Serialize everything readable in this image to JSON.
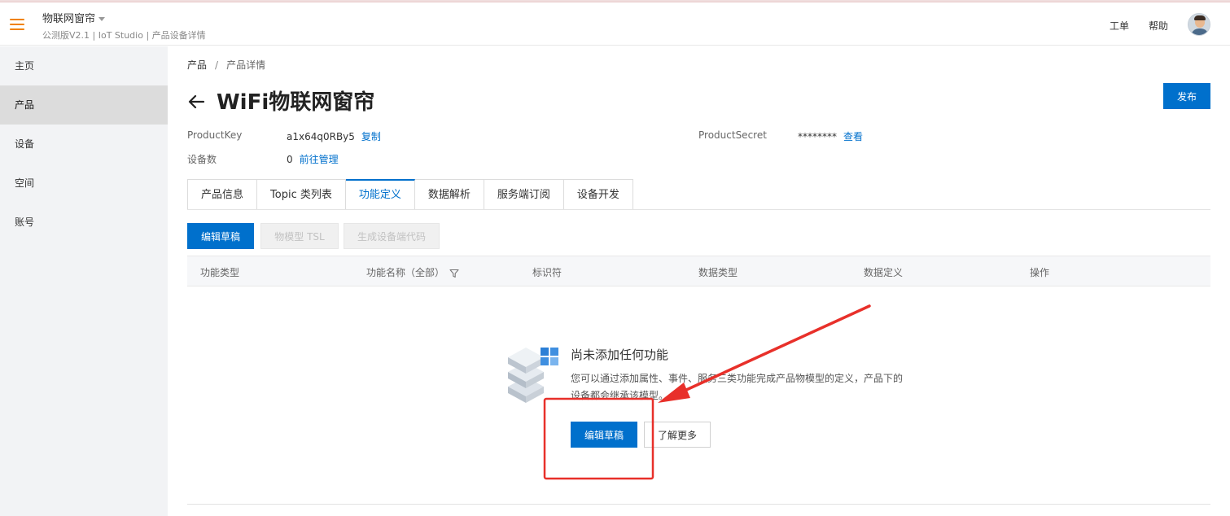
{
  "header": {
    "app_title": "物联网窗帘",
    "app_subtitle": "公测版V2.1 | IoT Studio | 产品设备详情",
    "work_order": "工单",
    "help": "帮助"
  },
  "sidebar": {
    "items": [
      {
        "label": "主页"
      },
      {
        "label": "产品"
      },
      {
        "label": "设备"
      },
      {
        "label": "空间"
      },
      {
        "label": "账号"
      }
    ]
  },
  "breadcrumb": {
    "root": "产品",
    "separator": "/",
    "current": "产品详情"
  },
  "page": {
    "title": "WiFi物联网窗帘",
    "publish_label": "发布"
  },
  "meta": {
    "product_key_label": "ProductKey",
    "product_key_value": "a1x64q0RBy5",
    "copy_link": "复制",
    "product_secret_label": "ProductSecret",
    "product_secret_value": "********",
    "view_link": "查看",
    "device_count_label": "设备数",
    "device_count_value": "0",
    "manage_link": "前往管理"
  },
  "tabs": [
    {
      "label": "产品信息"
    },
    {
      "label": "Topic 类列表"
    },
    {
      "label": "功能定义"
    },
    {
      "label": "数据解析"
    },
    {
      "label": "服务端订阅"
    },
    {
      "label": "设备开发"
    }
  ],
  "toolbar": {
    "edit_draft": "编辑草稿",
    "tsl": "物模型 TSL",
    "generate_code": "生成设备端代码"
  },
  "table": {
    "columns": [
      "功能类型",
      "功能名称（全部）",
      "标识符",
      "数据类型",
      "数据定义",
      "操作"
    ]
  },
  "empty": {
    "title": "尚未添加任何功能",
    "description": "您可以通过添加属性、事件、服务三类功能完成产品物模型的定义，产品下的设备都会继承该模型。",
    "edit_draft": "编辑草稿",
    "learn_more": "了解更多"
  },
  "colors": {
    "accent": "#0070cc",
    "brand_orange": "#f08200",
    "annotation_red": "#e8302a"
  }
}
